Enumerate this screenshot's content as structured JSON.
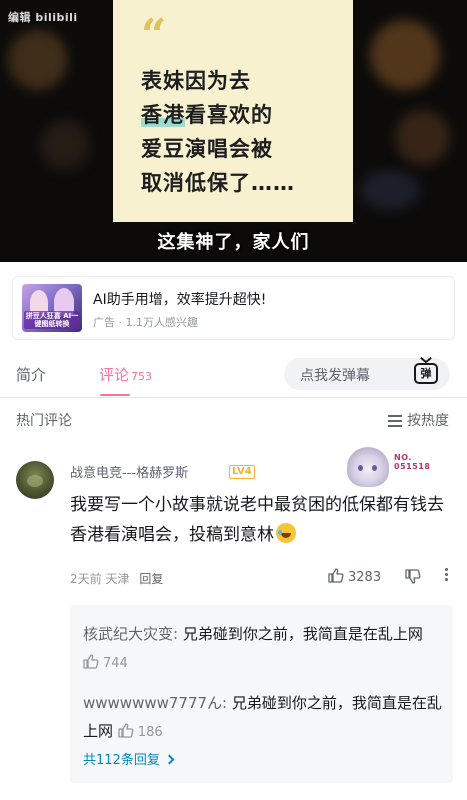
{
  "video": {
    "watermark": "编辑 bilibili",
    "quote_lines": [
      "表妹因为去",
      "香港看喜欢的",
      "爱豆演唱会被",
      "取消低保了……"
    ],
    "quote_highlight": "香港",
    "subtitle": "这集神了，家人们"
  },
  "ad": {
    "thumb_caption": "拼豆人狂喜 AI一键图纸转换",
    "title": "AI助手用增，效率提升超快!",
    "label": "广告",
    "meta": "· 1.1万人感兴趣"
  },
  "tabs": {
    "intro": "简介",
    "comments": "评论",
    "comments_count": "753",
    "danmaku_placeholder": "点我发弹幕",
    "danmaku_icon_char": "弹"
  },
  "hot": {
    "title": "热门评论",
    "sort_label": "按热度"
  },
  "comment": {
    "username": "战意电竞---格赫罗斯",
    "level": "LV4",
    "fan_no_label": "NO.",
    "fan_no": "051518",
    "text": "我要写一个小故事就说老中最贫困的低保都有钱去香港看演唱会，投稿到意林",
    "time": "2天前",
    "location": "天津",
    "reply_label": "回复",
    "likes": "3283"
  },
  "replies": {
    "items": [
      {
        "name": "核武纪大灾变:",
        "text": "兄弟碰到你之前，我简直是在乱上网",
        "likes": "744"
      },
      {
        "name": "wwwwwww7777ん:",
        "text": "兄弟碰到你之前，我简直是在乱上网",
        "likes": "186"
      }
    ],
    "view_all": "共112条回复"
  },
  "colors": {
    "accent": "#fb7299",
    "link": "#008ac5",
    "quote_bg": "#f7f1cf",
    "level": "#ffb027"
  }
}
